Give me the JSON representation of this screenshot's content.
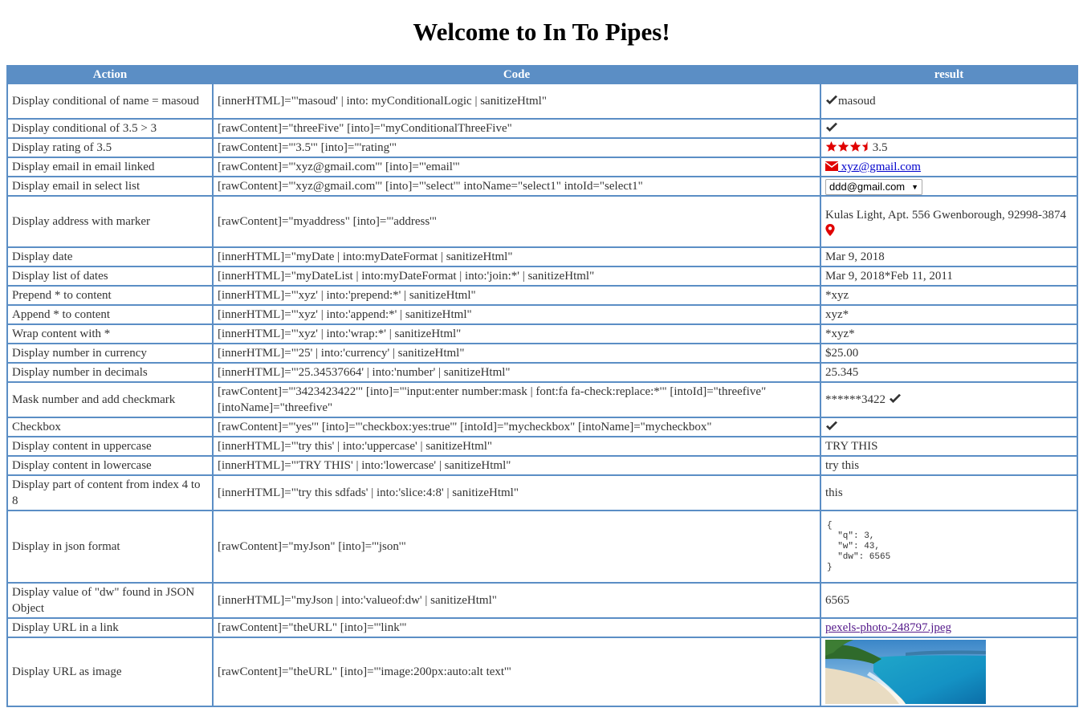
{
  "page": {
    "title": "Welcome to In To Pipes!"
  },
  "colors": {
    "header_bg": "#5b8ec5",
    "accent_red": "#e00000",
    "check": "#333333",
    "link": "#0000cc",
    "visited_link": "#551a8b"
  },
  "table": {
    "headers": {
      "action": "Action",
      "code": "Code",
      "result": "result"
    },
    "rows": [
      {
        "action": "Display conditional of name = masoud",
        "code": "[innerHTML]=\"'masoud' | into: myConditionalLogic | sanitizeHtml\"",
        "result": "masoud",
        "icon": "check-icon"
      },
      {
        "action": "Display conditional of 3.5 > 3",
        "code": "[rawContent]=\"threeFive\" [into]=\"myConditionalThreeFive\"",
        "result": "",
        "icon": "check-icon"
      },
      {
        "action": "Display rating of 3.5",
        "code": "[rawContent]=\"'3.5'\" [into]=\"'rating'\"",
        "result": "3.5",
        "rating": 3.5,
        "icon": "star-icon"
      },
      {
        "action": "Display email in email linked",
        "code": "[rawContent]=\"'xyz@gmail.com'\" [into]=\"'email'\"",
        "result": " xyz@gmail.com",
        "icon": "envelope-icon"
      },
      {
        "action": "Display email in select list",
        "code": "[rawContent]=\"'xyz@gmail.com'\" [into]=\"'select'\" intoName=\"select1\" intoId=\"select1\"",
        "result": "ddd@gmail.com"
      },
      {
        "action": "Display address with marker",
        "code": "[rawContent]=\"myaddress\" [into]=\"'address'\"",
        "result": "Kulas Light, Apt. 556 Gwenborough, 92998-3874",
        "icon": "map-marker-icon"
      },
      {
        "action": "Display date",
        "code": "[innerHTML]=\"myDate | into:myDateFormat | sanitizeHtml\"",
        "result": "Mar 9, 2018"
      },
      {
        "action": "Display list of dates",
        "code": "[innerHTML]=\"myDateList | into:myDateFormat | into:'join:*' | sanitizeHtml\"",
        "result": "Mar 9, 2018*Feb 11, 2011"
      },
      {
        "action": "Prepend * to content",
        "code": "[innerHTML]=\"'xyz' | into:'prepend:*' | sanitizeHtml\"",
        "result": "*xyz"
      },
      {
        "action": "Append * to content",
        "code": "[innerHTML]=\"'xyz' | into:'append:*' | sanitizeHtml\"",
        "result": "xyz*"
      },
      {
        "action": "Wrap content with *",
        "code": "[innerHTML]=\"'xyz' | into:'wrap:*' | sanitizeHtml\"",
        "result": "*xyz*"
      },
      {
        "action": "Display number in currency",
        "code": "[innerHTML]=\"'25' | into:'currency' | sanitizeHtml\"",
        "result": "$25.00"
      },
      {
        "action": "Display number in decimals",
        "code": "[innerHTML]=\"'25.34537664' | into:'number' | sanitizeHtml\"",
        "result": "25.345"
      },
      {
        "action": "Mask number and add checkmark",
        "code": "[rawContent]=\"'3423423422'\" [into]=\"'input:enter number:mask | font:fa fa-check:replace:*'\" [intoId]=\"threefive\" [intoName]=\"threefive\"",
        "result": "******3422",
        "icon": "check-icon"
      },
      {
        "action": "Checkbox",
        "code": "[rawContent]=\"'yes'\" [into]=\"'checkbox:yes:true'\" [intoId]=\"mycheckbox\" [intoName]=\"mycheckbox\"",
        "result": "",
        "icon": "check-icon"
      },
      {
        "action": "Display content in uppercase",
        "code": "[innerHTML]=\"'try this' | into:'uppercase' | sanitizeHtml\"",
        "result": "TRY THIS"
      },
      {
        "action": "Display content in lowercase",
        "code": "[innerHTML]=\"'TRY THIS' | into:'lowercase' | sanitizeHtml\"",
        "result": "try this"
      },
      {
        "action": "Display part of content from index 4 to 8",
        "code": "[innerHTML]=\"'try this sdfads' | into:'slice:4:8' | sanitizeHtml\"",
        "result": "this"
      },
      {
        "action": "Display in json format",
        "code": "[rawContent]=\"myJson\" [into]=\"'json'\"",
        "result": "{\n  \"q\": 3,\n  \"w\": 43,\n  \"dw\": 6565\n}"
      },
      {
        "action": "Display value of \"dw\" found in JSON Object",
        "code": "[innerHTML]=\"myJson | into:'valueof:dw' | sanitizeHtml\"",
        "result": "6565"
      },
      {
        "action": "Display URL in a link",
        "code": "[rawContent]=\"theURL\" [into]=\"'link'\"",
        "result": "pexels-photo-248797.jpeg"
      },
      {
        "action": "Display URL as image",
        "code": "[rawContent]=\"theURL\" [into]=\"'image:200px:auto:alt text'\"",
        "result": "",
        "icon": "beach-image"
      }
    ]
  }
}
